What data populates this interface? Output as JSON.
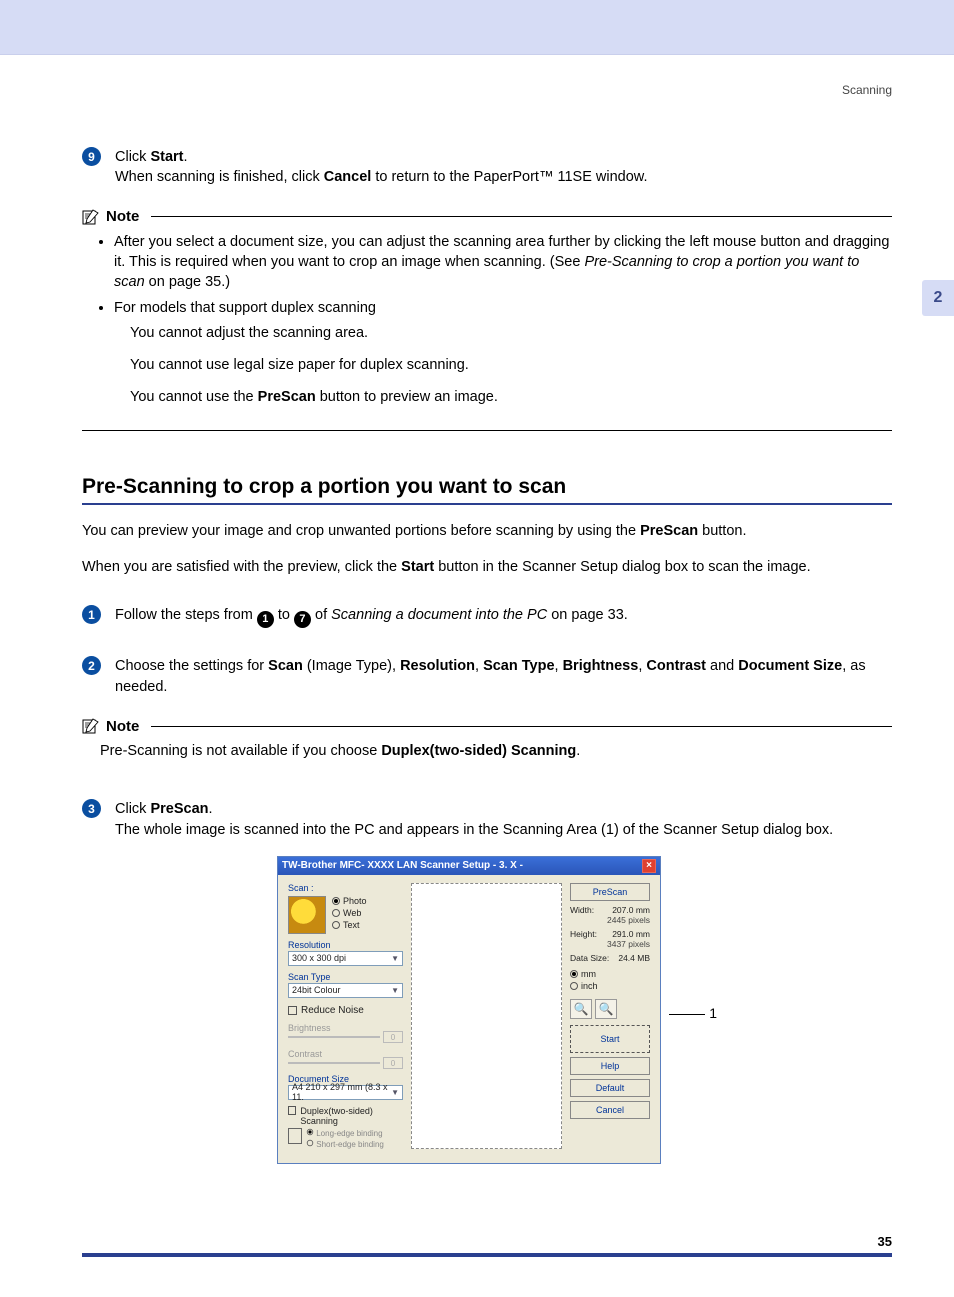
{
  "header": {
    "section": "Scanning"
  },
  "chapter_tab": "2",
  "step9": {
    "num": "9",
    "line1_pre": "Click ",
    "line1_bold": "Start",
    "line1_post": ".",
    "line2_pre": "When scanning is finished, click ",
    "line2_bold": "Cancel",
    "line2_post": " to return to the PaperPort™ 11SE window."
  },
  "note1": {
    "label": "Note",
    "b1_pre": "After you select a document size, you can adjust the scanning area further by clicking the left mouse button and dragging it. This is required when you want to crop an image when scanning. (See ",
    "b1_ital": "Pre-Scanning to crop a portion you want to scan",
    "b1_post": " on page 35.)",
    "b2": "For models that support duplex scanning",
    "b2s1": "You cannot adjust the scanning area.",
    "b2s2": "You cannot use legal size paper for duplex scanning.",
    "b2s3_pre": "You cannot use the ",
    "b2s3_bold": "PreScan",
    "b2s3_post": " button to preview an image."
  },
  "h2": "Pre-Scanning to crop a portion you want to scan",
  "p1_pre": "You can preview your image and crop unwanted portions before scanning by using the ",
  "p1_bold": "PreScan",
  "p1_post": " button.",
  "p2_pre": "When you are satisfied with the preview, click the ",
  "p2_bold": "Start",
  "p2_post": " button in the Scanner Setup dialog box to scan the image.",
  "stepA": {
    "num": "1",
    "pre": "Follow the steps from ",
    "c1": "1",
    "mid": " to ",
    "c2": "7",
    "post_pre": " of ",
    "ital": "Scanning a document into the PC",
    "post": " on page 33."
  },
  "stepB": {
    "num": "2",
    "pre": "Choose the settings for ",
    "b1": "Scan",
    "mid1": " (Image Type), ",
    "b2": "Resolution",
    "mid2": ", ",
    "b3": "Scan Type",
    "mid3": ", ",
    "b4": "Brightness",
    "mid4": ", ",
    "b5": "Contrast",
    "mid5": " and ",
    "b6": "Document Size",
    "post": ", as needed."
  },
  "note2": {
    "label": "Note",
    "text_pre": "Pre-Scanning is not available if you choose ",
    "text_bold": "Duplex(two-sided) Scanning",
    "text_post": "."
  },
  "stepC": {
    "num": "3",
    "l1_pre": "Click ",
    "l1_bold": "PreScan",
    "l1_post": ".",
    "l2": "The whole image is scanned into the PC and appears in the Scanning Area (1) of the Scanner Setup dialog box."
  },
  "dialog": {
    "title": "TW-Brother MFC- XXXX   LAN Scanner Setup - 3. X -",
    "scan_label": "Scan :",
    "radio_photo": "Photo",
    "radio_web": "Web",
    "radio_text": "Text",
    "res_label": "Resolution",
    "res_value": "300 x 300 dpi",
    "scantype_label": "Scan Type",
    "scantype_value": "24bit Colour",
    "reduce_noise": "Reduce Noise",
    "brightness": "Brightness",
    "contrast": "Contrast",
    "slider_val": "0",
    "docsize_label": "Document Size",
    "docsize_value": "A4 210 x 297 mm (8.3 x 11.",
    "duplex": "Duplex(two-sided) Scanning",
    "long_edge": "Long-edge binding",
    "short_edge": "Short-edge binding",
    "prescan": "PreScan",
    "width_l": "Width:",
    "width_v": "207.0 mm",
    "width_px": "2445 pixels",
    "height_l": "Height:",
    "height_v": "291.0 mm",
    "height_px": "3437 pixels",
    "datasize_l": "Data Size:",
    "datasize_v": "24.4 MB",
    "unit_mm": "mm",
    "unit_inch": "inch",
    "btn_start": "Start",
    "btn_help": "Help",
    "btn_default": "Default",
    "btn_cancel": "Cancel"
  },
  "callout": "1",
  "page_number": "35"
}
